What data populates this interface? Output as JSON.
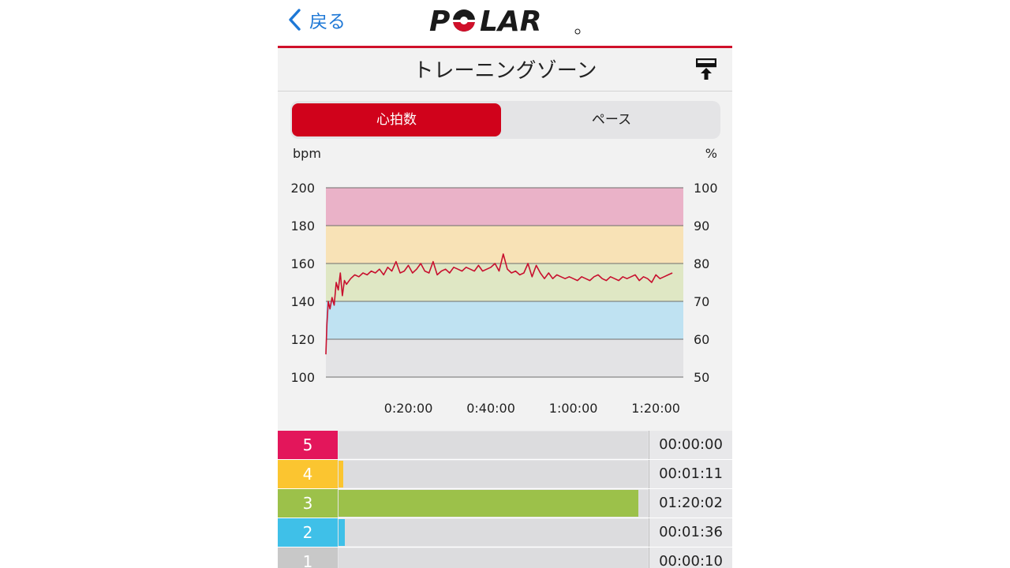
{
  "header": {
    "back_label": "戻る",
    "logo_text": "POLAR",
    "title": "トレーニングゾーン"
  },
  "tabs": [
    {
      "label": "心拍数",
      "active": true
    },
    {
      "label": "ペース",
      "active": false
    }
  ],
  "colors": {
    "brand_red": "#d0021b",
    "zone5": "#e3165b",
    "zone4": "#fbc530",
    "zone3": "#9cc14a",
    "zone2": "#3fc0e8",
    "zone1": "#c8c8c8"
  },
  "chart_data": {
    "type": "line",
    "ylabel": "bpm",
    "y2label": "%",
    "ylim": [
      100,
      200
    ],
    "y2lim": [
      50,
      100
    ],
    "yticks": [
      "100",
      "120",
      "140",
      "160",
      "180",
      "200"
    ],
    "y2ticks": [
      "50",
      "60",
      "70",
      "80",
      "90",
      "100"
    ],
    "xlim": [
      0,
      5200
    ],
    "xticks": [
      {
        "t": 1200,
        "label": "0:20:00"
      },
      {
        "t": 2400,
        "label": "0:40:00"
      },
      {
        "t": 3600,
        "label": "1:00:00"
      },
      {
        "t": 4800,
        "label": "1:20:00"
      }
    ],
    "zone_bands": [
      {
        "zone": "1",
        "from": 100,
        "to": 120,
        "color": "#e3e3e5"
      },
      {
        "zone": "2",
        "from": 120,
        "to": 140,
        "color": "#bfe2f2"
      },
      {
        "zone": "3",
        "from": 140,
        "to": 160,
        "color": "#dfe7c4"
      },
      {
        "zone": "4",
        "from": 160,
        "to": 180,
        "color": "#f8e2b6"
      },
      {
        "zone": "5",
        "from": 180,
        "to": 200,
        "color": "#eab2c8"
      }
    ],
    "series": [
      {
        "line_color": "#c8102e",
        "x": [
          0,
          15,
          35,
          60,
          90,
          120,
          150,
          180,
          210,
          240,
          270,
          300,
          360,
          420,
          480,
          540,
          600,
          660,
          720,
          780,
          840,
          900,
          960,
          1020,
          1080,
          1140,
          1200,
          1260,
          1320,
          1380,
          1440,
          1500,
          1560,
          1620,
          1680,
          1740,
          1800,
          1860,
          1920,
          1980,
          2040,
          2100,
          2160,
          2220,
          2280,
          2340,
          2400,
          2460,
          2520,
          2580,
          2640,
          2700,
          2760,
          2820,
          2880,
          2940,
          3000,
          3060,
          3120,
          3180,
          3240,
          3300,
          3360,
          3420,
          3480,
          3540,
          3600,
          3660,
          3720,
          3780,
          3840,
          3900,
          3960,
          4020,
          4080,
          4140,
          4200,
          4260,
          4320,
          4380,
          4440,
          4500,
          4560,
          4620,
          4680,
          4740,
          4800,
          4860,
          4920,
          4980,
          5040
        ],
        "y": [
          112,
          128,
          140,
          136,
          142,
          138,
          150,
          146,
          155,
          143,
          151,
          149,
          152,
          154,
          153,
          155,
          154,
          156,
          155,
          157,
          154,
          158,
          156,
          161,
          155,
          156,
          159,
          155,
          157,
          160,
          156,
          155,
          161,
          154,
          156,
          157,
          155,
          158,
          157,
          156,
          158,
          157,
          156,
          159,
          156,
          157,
          158,
          160,
          156,
          165,
          157,
          155,
          156,
          154,
          155,
          160,
          153,
          159,
          155,
          152,
          155,
          152,
          154,
          153,
          152,
          153,
          152,
          151,
          153,
          152,
          151,
          153,
          154,
          152,
          151,
          153,
          152,
          151,
          153,
          152,
          153,
          154,
          151,
          153,
          152,
          150,
          154,
          152,
          153,
          154,
          155
        ]
      }
    ]
  },
  "zones": [
    {
      "label": "5",
      "time": "00:00:00",
      "fraction": 0.0,
      "color": "#e3165b"
    },
    {
      "label": "4",
      "time": "00:01:11",
      "fraction": 0.015,
      "color": "#fbc530"
    },
    {
      "label": "3",
      "time": "01:20:02",
      "fraction": 0.97,
      "color": "#9cc14a"
    },
    {
      "label": "2",
      "time": "00:01:36",
      "fraction": 0.02,
      "color": "#3fc0e8"
    },
    {
      "label": "1",
      "time": "00:00:10",
      "fraction": 0.0,
      "color": "#c8c8c8"
    }
  ]
}
